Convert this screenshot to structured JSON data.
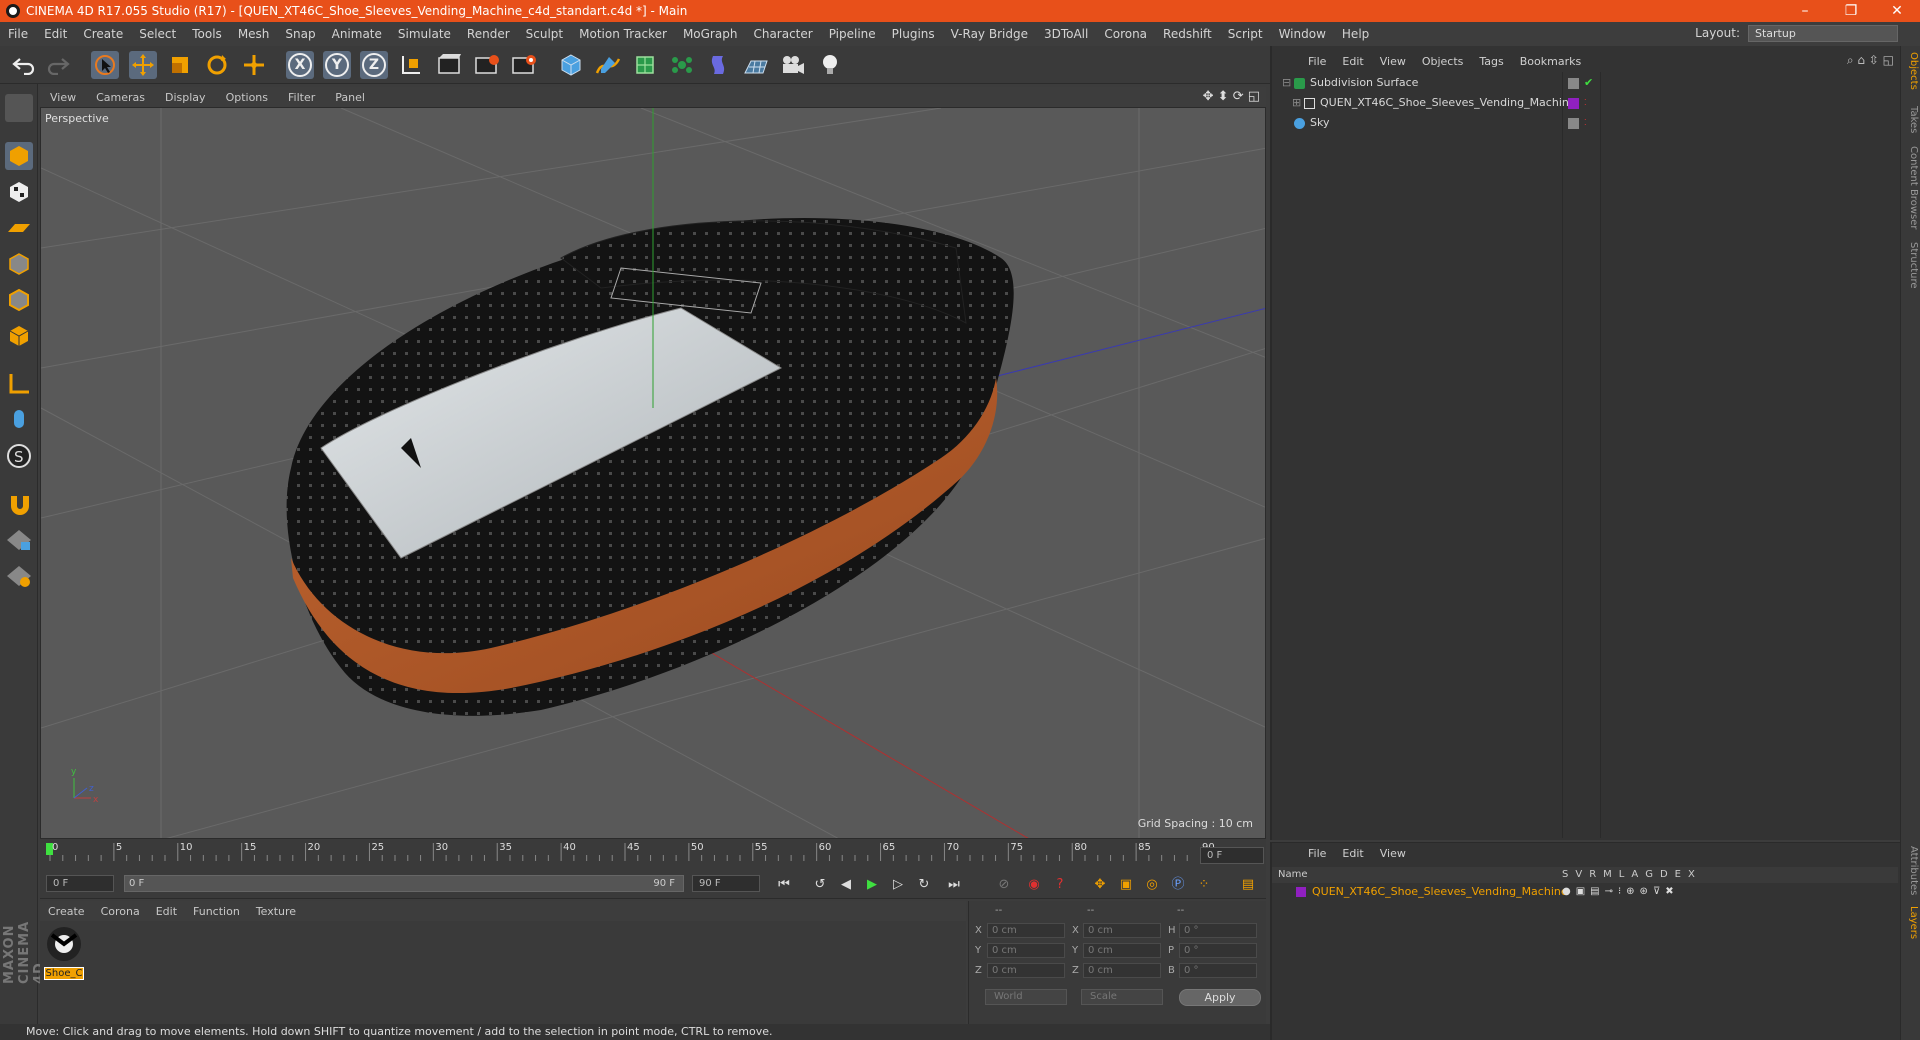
{
  "window": {
    "title": "CINEMA 4D R17.055 Studio (R17) - [QUEN_XT46C_Shoe_Sleeves_Vending_Machine_c4d_standart.c4d *] - Main",
    "controls": [
      "–",
      "❐",
      "✕"
    ]
  },
  "menu": [
    "File",
    "Edit",
    "Create",
    "Select",
    "Tools",
    "Mesh",
    "Snap",
    "Animate",
    "Simulate",
    "Render",
    "Sculpt",
    "Motion Tracker",
    "MoGraph",
    "Character",
    "Pipeline",
    "Plugins",
    "V-Ray Bridge",
    "3DToAll",
    "Corona",
    "Redshift",
    "Script",
    "Window",
    "Help"
  ],
  "layout": {
    "label": "Layout:",
    "value": "Startup"
  },
  "toolbar": {
    "x_label": "X",
    "y_label": "Y",
    "z_label": "Z"
  },
  "viewport": {
    "menu": [
      "View",
      "Cameras",
      "Display",
      "Options",
      "Filter",
      "Panel"
    ],
    "camera": "Perspective",
    "grid_spacing": "Grid Spacing : 10 cm"
  },
  "timeline": {
    "ticks": [
      "0",
      "5",
      "10",
      "15",
      "20",
      "25",
      "30",
      "35",
      "40",
      "45",
      "50",
      "55",
      "60",
      "65",
      "70",
      "75",
      "80",
      "85",
      "90"
    ],
    "current_frame_field": "0 F",
    "start_field": "0 F",
    "range_start": "0 F",
    "range_end": "90 F",
    "end_field": "90 F"
  },
  "materials": {
    "menu": [
      "Create",
      "Corona",
      "Edit",
      "Function",
      "Texture"
    ],
    "items": [
      {
        "name": "Shoe_C"
      }
    ]
  },
  "coordinates": {
    "headers": [
      "--",
      "--",
      "--"
    ],
    "rows": [
      {
        "a": "X",
        "a_val": "0 cm",
        "b": "X",
        "b_val": "0 cm",
        "c": "H",
        "c_val": "0 °"
      },
      {
        "a": "Y",
        "a_val": "0 cm",
        "b": "Y",
        "b_val": "0 cm",
        "c": "P",
        "c_val": "0 °"
      },
      {
        "a": "Z",
        "a_val": "0 cm",
        "b": "Z",
        "b_val": "0 cm",
        "c": "B",
        "c_val": "0 °"
      }
    ],
    "world": "World",
    "scale": "Scale",
    "apply": "Apply"
  },
  "status": "Move: Click and drag to move elements. Hold down SHIFT to quantize movement / add to the selection in point mode, CTRL to remove.",
  "objects_panel": {
    "menu": [
      "File",
      "Edit",
      "View",
      "Objects",
      "Tags",
      "Bookmarks"
    ],
    "items": [
      {
        "name": "Subdivision Surface"
      },
      {
        "name": "QUEN_XT46C_Shoe_Sleeves_Vending_Machine"
      },
      {
        "name": "Sky"
      }
    ]
  },
  "layers_panel": {
    "menu": [
      "File",
      "Edit",
      "View"
    ],
    "name_header": "Name",
    "columns": [
      "S",
      "V",
      "R",
      "M",
      "L",
      "A",
      "G",
      "D",
      "E",
      "X"
    ],
    "item": "QUEN_XT46C_Shoe_Sleeves_Vending_Machine"
  },
  "right_tabs": [
    "Objects",
    "Takes",
    "Content Browser",
    "Structure",
    "Attributes",
    "Layers"
  ],
  "brand": "MAXON CINEMA 4D",
  "colors": {
    "title_bar": "#e8501a",
    "accent": "#f0a000",
    "layer_color": "#9020c0"
  }
}
